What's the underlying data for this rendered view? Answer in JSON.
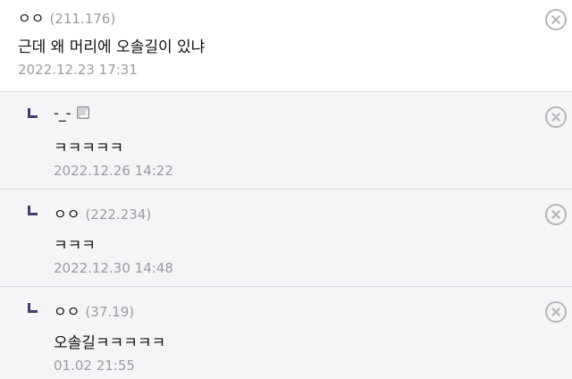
{
  "comments": [
    {
      "author": "ㅇㅇ",
      "ip": "(211.176)",
      "text": "근데 왜 머리에 오솔길이 있냐",
      "date": "2022.12.23 17:31"
    }
  ],
  "replies": [
    {
      "author": "-_-",
      "ip": "",
      "icon": "member-badge-icon",
      "text": "ㅋㅋㅋㅋㅋ",
      "date": "2022.12.26 14:22"
    },
    {
      "author": "ㅇㅇ",
      "ip": "(222.234)",
      "text": "ㅋㅋㅋ",
      "date": "2022.12.30 14:48"
    },
    {
      "author": "ㅇㅇ",
      "ip": "(37.19)",
      "text": "오솔길ㅋㅋㅋㅋㅋ",
      "date": "01.02 21:55"
    }
  ],
  "colors": {
    "reply_background": "#f5f5f8",
    "divider": "#dcdce4",
    "meta_text": "#9a9aa2",
    "reply_marker": "#3b3f6e"
  }
}
